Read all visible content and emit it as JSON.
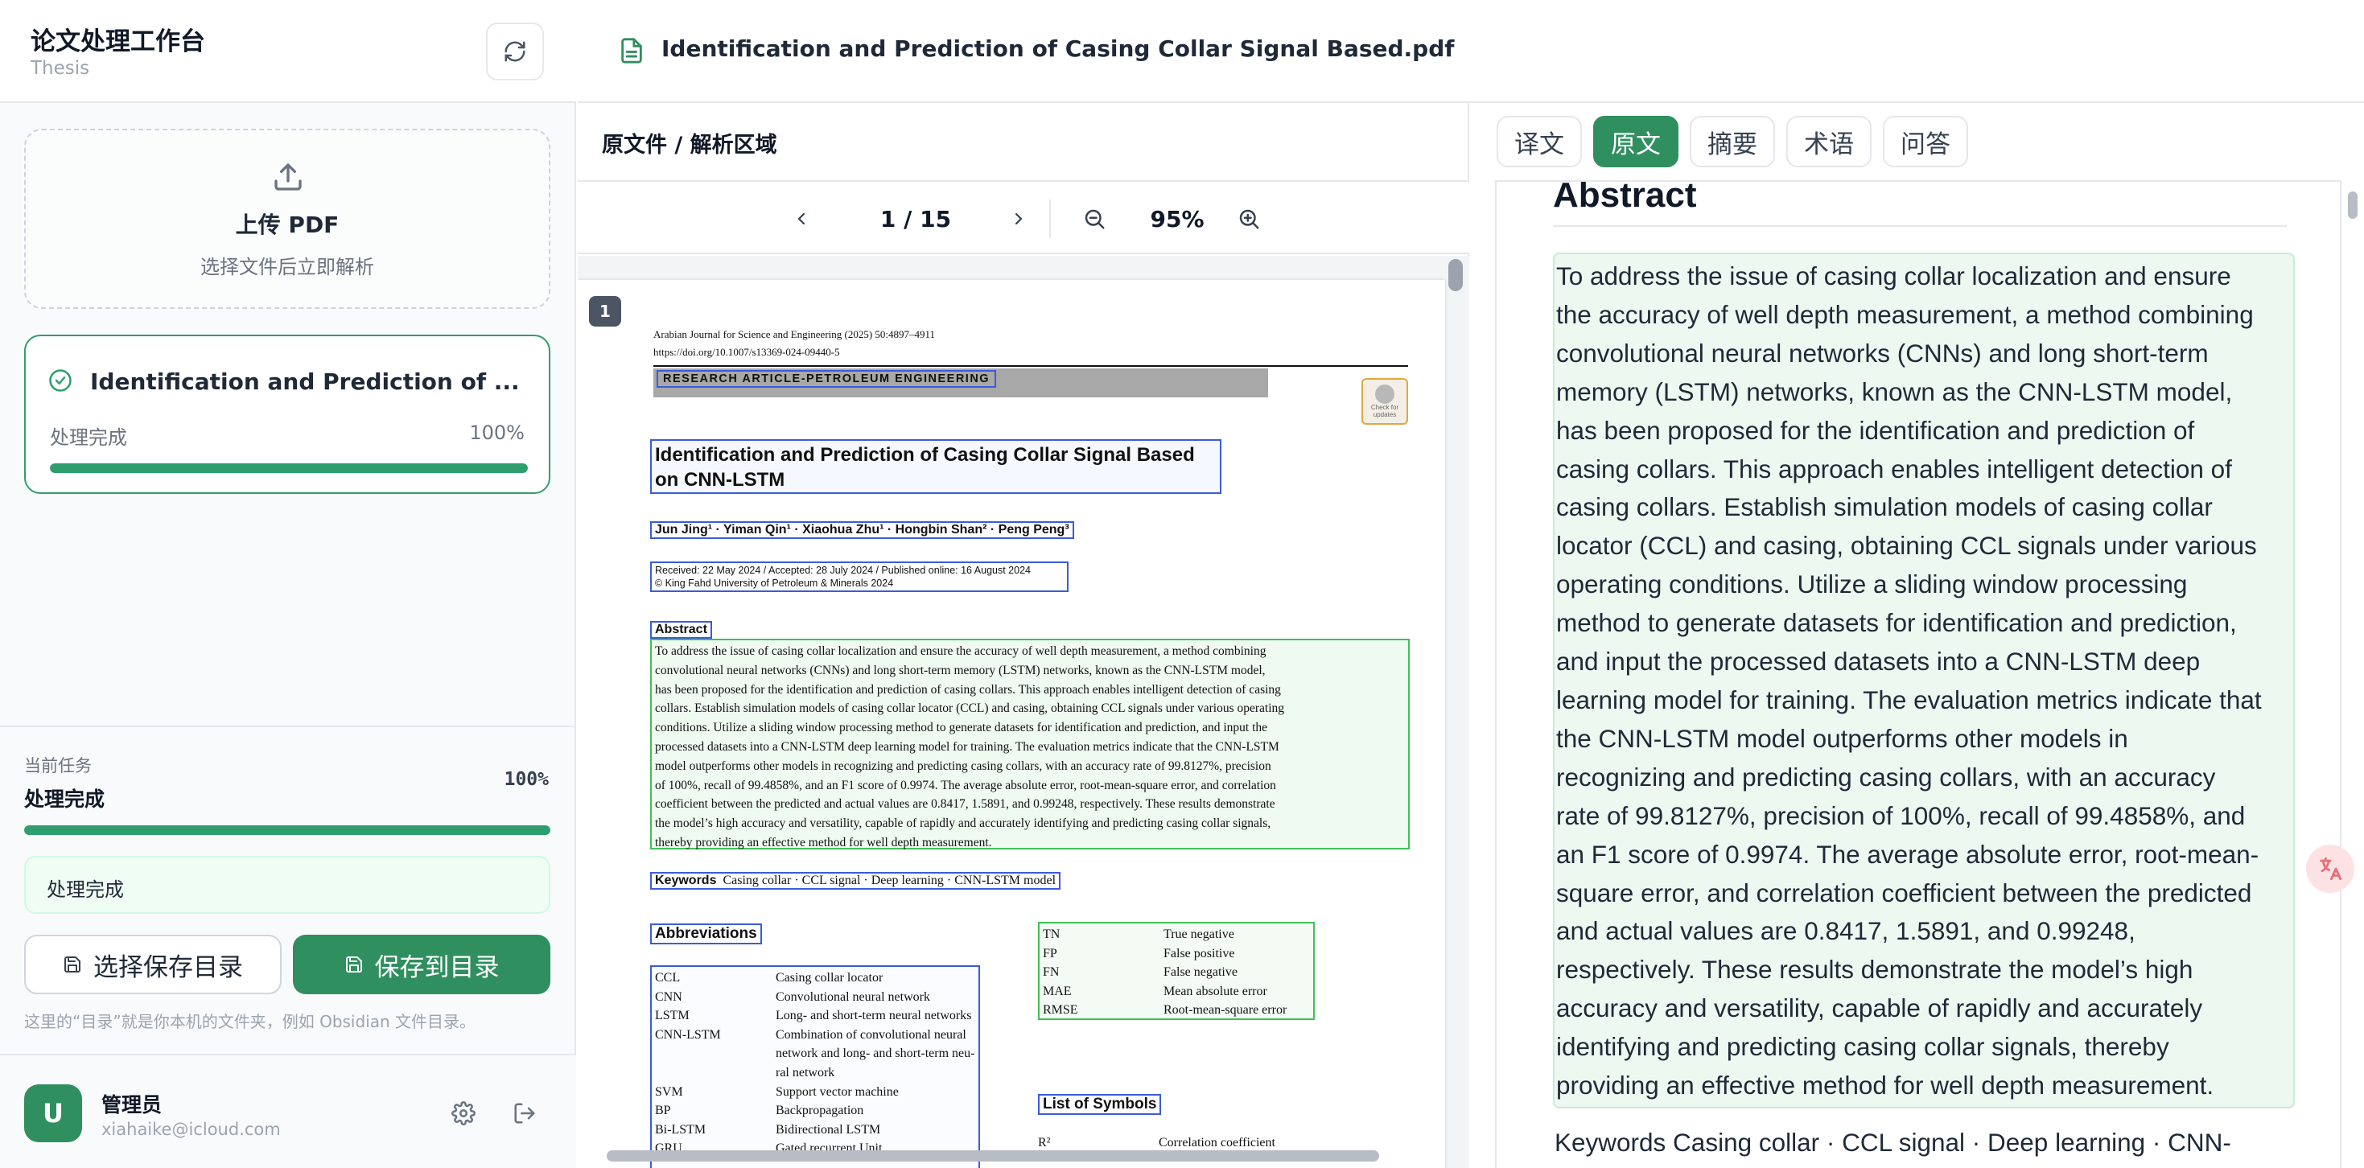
{
  "app": {
    "title": "论文处理工作台",
    "subtitle": "Thesis"
  },
  "upload": {
    "title": "上传 PDF",
    "subtitle": "选择文件后立即解析"
  },
  "file_card": {
    "name": "Identification and Prediction of ...",
    "status": "处理完成",
    "percent_text": "100%",
    "progress": 1.0
  },
  "task": {
    "label": "当前任务",
    "value": "处理完成",
    "percent_text": "100%",
    "progress": 1.0,
    "message": "处理完成"
  },
  "actions": {
    "choose_dir": "选择保存目录",
    "save_dir": "保存到目录",
    "hint": "这里的“目录”就是你本机的文件夹，例如 Obsidian 文件目录。"
  },
  "user": {
    "avatar_letter": "U",
    "name": "管理员",
    "email": "xiahaike@icloud.com"
  },
  "document": {
    "title": "Identification and Prediction of Casing Collar Signal Based.pdf"
  },
  "pdf_pane": {
    "title": "原文件 / 解析区域",
    "page_indicator": "1 / 15",
    "zoom": "95%",
    "page_badge": "1"
  },
  "pdf_page": {
    "journal": "Arabian Journal for Science and Engineering (2025) 50:4897–4911",
    "doi": "https://doi.org/10.1007/s13369-024-09440-5",
    "category": "RESEARCH ARTICLE-PETROLEUM ENGINEERING",
    "check_badge": "Check for updates",
    "title_line1": "Identification and Prediction of Casing Collar Signal Based",
    "title_line2": "on CNN-LSTM",
    "authors": "Jun Jing¹ · Yiman Qin¹ · Xiaohua Zhu¹ · Hongbin Shan² · Peng Peng³",
    "received": "Received: 22 May 2024 / Accepted: 28 July 2024 / Published online: 16 August 2024",
    "copyright": "© King Fahd University of Petroleum & Minerals 2024",
    "abstract_label": "Abstract",
    "abstract_lines": [
      "To address the issue of casing collar localization and ensure the accuracy of well depth measurement, a method combining",
      "convolutional neural networks (CNNs) and long short-term memory (LSTM) networks, known as the CNN-LSTM model,",
      "has been proposed for the identification and prediction of casing collars. This approach enables intelligent detection of casing",
      "collars. Establish simulation models of casing collar locator (CCL) and casing, obtaining CCL signals under various operating",
      "conditions. Utilize a sliding window processing method to generate datasets for identification and prediction, and input the",
      "processed datasets into a CNN-LSTM deep learning model for training. The evaluation metrics indicate that the CNN-LSTM",
      "model outperforms other models in recognizing and predicting casing collars, with an accuracy rate of 99.8127%, precision",
      "of 100%, recall of 99.4858%, and an F1 score of 0.9974. The average absolute error, root-mean-square error, and correlation",
      "coefficient between the predicted and actual values are 0.8417, 1.5891, and 0.99248, respectively. These results demonstrate",
      "the model’s high accuracy and versatility, capable of rapidly and accurately identifying and predicting casing collar signals,",
      "thereby providing an effective method for well depth measurement."
    ],
    "keywords_label": "Keywords",
    "keywords": "Casing collar · CCL signal · Deep learning · CNN-LSTM model",
    "abbr_label": "Abbreviations",
    "abbreviations": [
      [
        "CCL",
        "Casing collar locator"
      ],
      [
        "CNN",
        "Convolutional neural network"
      ],
      [
        "LSTM",
        "Long- and short-term neural networks"
      ],
      [
        "CNN-LSTM",
        "Combination of convolutional neural"
      ],
      [
        "",
        "network and long- and short-term neu-"
      ],
      [
        "",
        "ral network"
      ],
      [
        "SVM",
        "Support vector machine"
      ],
      [
        "BP",
        "Backpropagation"
      ],
      [
        "Bi-LSTM",
        "Bidirectional LSTM"
      ],
      [
        "GRU",
        "Gated recurrent Unit"
      ]
    ],
    "abbreviations_right": [
      [
        "TN",
        "True negative"
      ],
      [
        "FP",
        "False positive"
      ],
      [
        "FN",
        "False negative"
      ],
      [
        "MAE",
        "Mean absolute error"
      ],
      [
        "RMSE",
        "Root-mean-square error"
      ]
    ],
    "symbols_label": "List of Symbols",
    "symbols": [
      [
        "R²",
        "Correlation coefficient"
      ]
    ]
  },
  "tabs": [
    "译文",
    "原文",
    "摘要",
    "术语",
    "问答"
  ],
  "active_tab": "原文",
  "reader": {
    "heading": "Abstract",
    "abstract_lines": [
      "To address the issue of casing collar localization and ensure",
      "the accuracy of well depth measurement, a method combining",
      "convolutional neural networks (CNNs) and long short-term",
      "memory (LSTM) networks, known as the CNN-LSTM model,",
      "has been proposed for the identification and prediction of",
      "casing collars. This approach enables intelligent detection of",
      "casing collars. Establish simulation models of casing collar",
      "locator (CCL) and casing, obtaining CCL signals under various",
      "operating conditions. Utilize a sliding window processing",
      "method to generate datasets for identification and prediction,",
      "and input the processed datasets into a CNN-LSTM deep",
      "learning model for training. The evaluation metrics indicate that",
      "the CNN-LSTM model outperforms other models in",
      "recognizing and predicting casing collars, with an accuracy",
      "rate of 99.8127%, precision of 100%, recall of 99.4858%, and",
      "an F1 score of 0.9974. The average absolute error, root-mean-",
      "square error, and correlation coefficient between the predicted",
      "and actual values are 0.8417, 1.5891, and 0.99248,",
      "respectively. These results demonstrate the model’s high",
      "accuracy and versatility, capable of rapidly and accurately",
      "identifying and predicting casing collar signals, thereby",
      "providing an effective method for well depth measurement."
    ],
    "keywords_line": "Keywords Casing collar · CCL signal · Deep learning · CNN-"
  },
  "colors": {
    "accent": "#2f8f5f",
    "accent_light": "#ecf8f0",
    "pdf_box_blue": "#3b5bdb",
    "pdf_box_green": "#40c057"
  }
}
